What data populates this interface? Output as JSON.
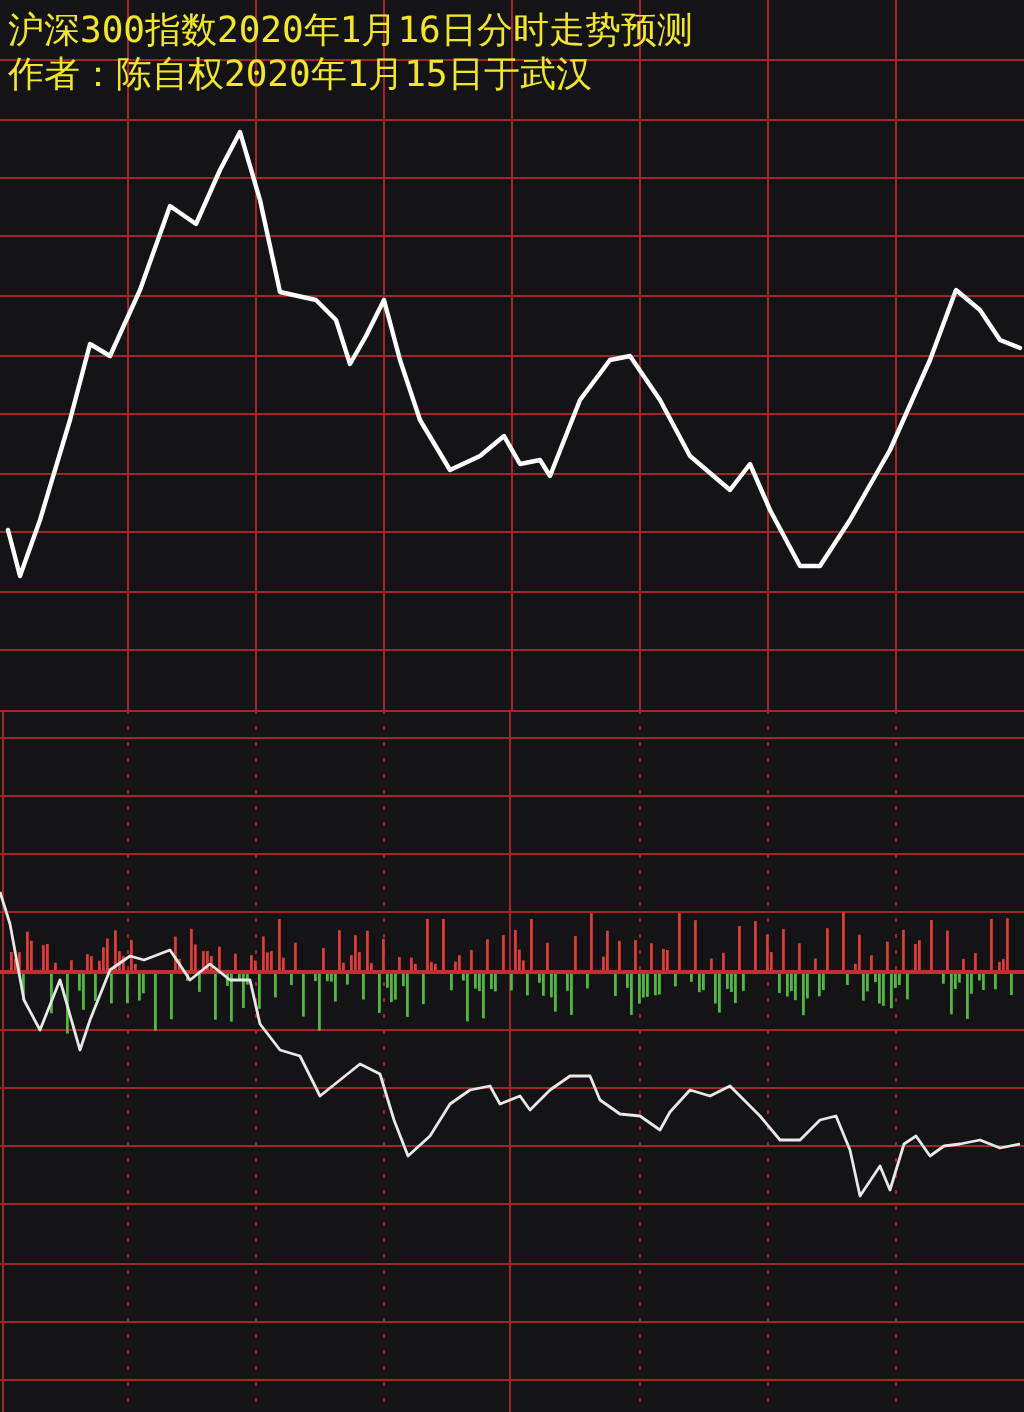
{
  "title": "沪深300指数2020年1月16日分时走势预测",
  "author_line": "作者：陈自权2020年1月15日于武汉"
}
